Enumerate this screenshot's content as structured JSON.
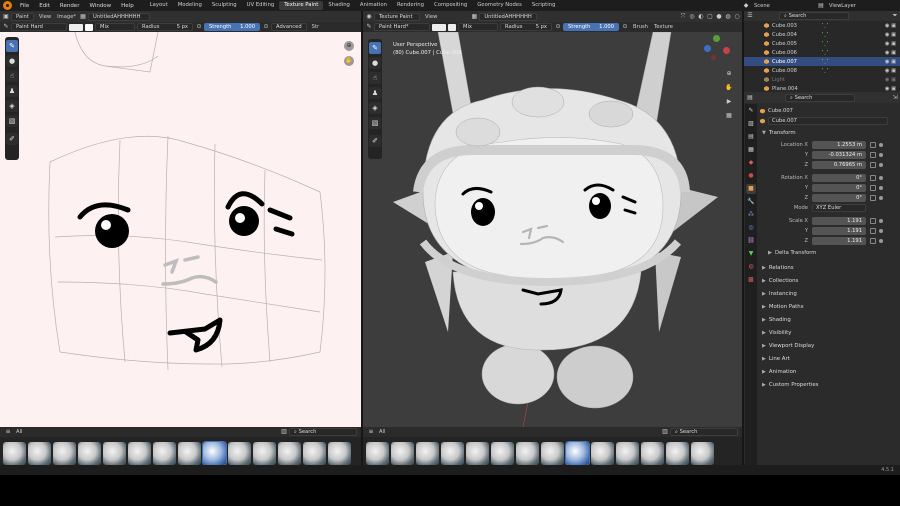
{
  "topbar": {
    "menus": [
      "File",
      "Edit",
      "Render",
      "Window",
      "Help"
    ],
    "workspaces": [
      "Layout",
      "Modeling",
      "Sculpting",
      "UV Editing",
      "Texture Paint",
      "Shading",
      "Animation",
      "Rendering",
      "Compositing",
      "Geometry Nodes",
      "Scripting"
    ],
    "active_workspace": "Texture Paint",
    "scene": "Scene",
    "view_layer": "ViewLayer"
  },
  "image_editor": {
    "mode": "Paint",
    "view_menu": "View",
    "image_menu": "Image*",
    "image_name": "UntitledAHHHHHH",
    "brush_name": "Paint Hard",
    "blend": "Mix",
    "radius_label": "Radius",
    "radius_value": "5 px",
    "strength_label": "Strength",
    "strength_value": "1.000",
    "advanced": "Advanced",
    "advanced_tail": "Str",
    "shelf_filter": "All",
    "search_placeholder": "Search"
  },
  "viewport": {
    "mode": "Texture Paint",
    "view_menu": "View",
    "image_name": "UntitledAHHHHHH",
    "brush_name": "Paint Hard*",
    "blend": "Mix",
    "radius_label": "Radius",
    "radius_value": "5 px",
    "strength_label": "Strength",
    "strength_value": "1.000",
    "brush_menu": "Brush",
    "texture_menu": "Texture",
    "overlay_line1": "User Perspective",
    "overlay_line2": "(80) Cube.007 | Cube.008",
    "shelf_filter": "All",
    "search_placeholder": "Search"
  },
  "outliner": {
    "search_placeholder": "Search",
    "items": [
      {
        "name": "Cube.003",
        "selected": false
      },
      {
        "name": "Cube.004",
        "selected": false
      },
      {
        "name": "Cube.005",
        "selected": false
      },
      {
        "name": "Cube.006",
        "selected": false
      },
      {
        "name": "Cube.007",
        "selected": true
      },
      {
        "name": "Cube.008",
        "selected": false
      },
      {
        "name": "Light",
        "selected": false
      },
      {
        "name": "Plane.004",
        "selected": false
      }
    ]
  },
  "properties": {
    "search_placeholder": "Search",
    "object_name": "Cube.007",
    "object_field": "Cube.007",
    "transform_title": "Transform",
    "location_x_label": "Location X",
    "location_x": "1.2553 m",
    "location_y_label": "Y",
    "location_y": "-0.031324 m",
    "location_z_label": "Z",
    "location_z": "0.76965 m",
    "rotation_x_label": "Rotation X",
    "rotation_x": "0°",
    "rotation_y_label": "Y",
    "rotation_y": "0°",
    "rotation_z_label": "Z",
    "rotation_z": "0°",
    "mode_label": "Mode",
    "mode_value": "XYZ Euler",
    "scale_x_label": "Scale X",
    "scale_x": "1.191",
    "scale_y_label": "Y",
    "scale_y": "1.191",
    "scale_z_label": "Z",
    "scale_z": "1.191",
    "delta_transform": "Delta Transform",
    "sections": [
      "Relations",
      "Collections",
      "Instancing",
      "Motion Paths",
      "Shading",
      "Visibility",
      "Viewport Display",
      "Line Art",
      "Animation",
      "Custom Properties"
    ]
  },
  "statusbar": {
    "version": "4.5.1"
  },
  "colors": {
    "accent": "#4772b3",
    "canvas": "#fdf1f1",
    "viewport_bg": "#3d3d3d"
  }
}
